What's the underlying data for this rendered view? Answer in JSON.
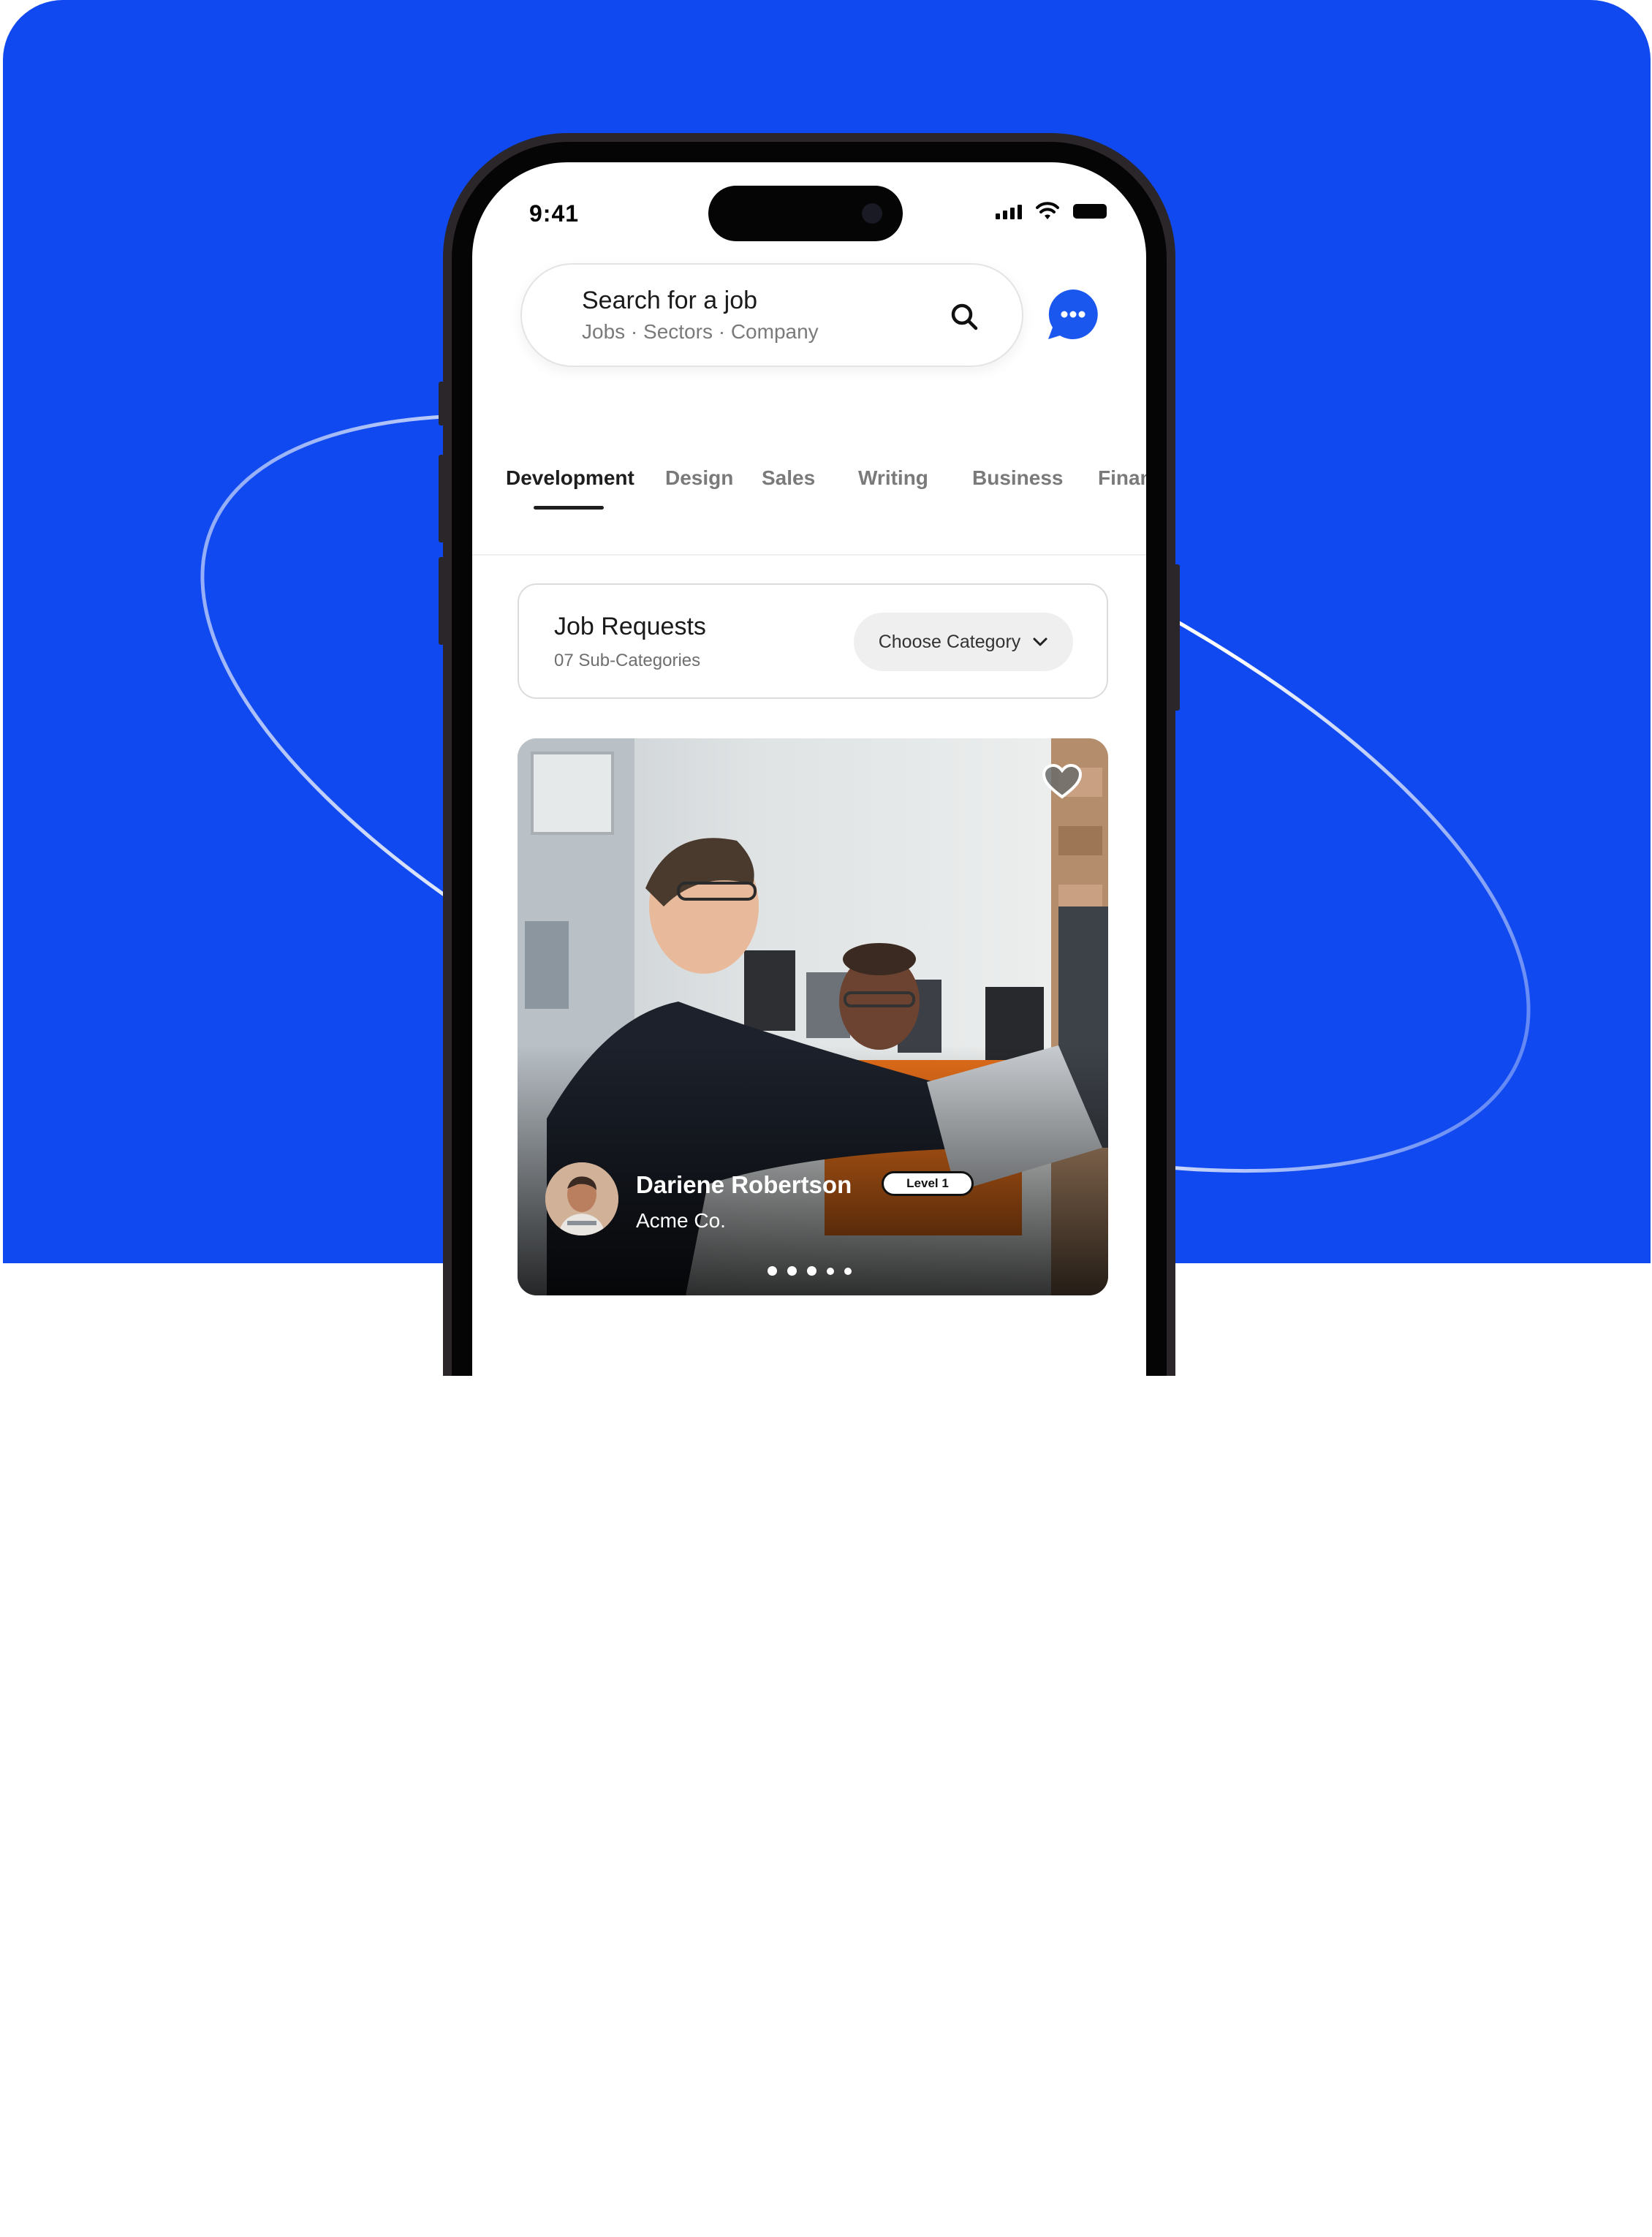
{
  "status_bar": {
    "time": "9:41"
  },
  "search": {
    "title": "Search for a job",
    "subtitle": "Jobs · Sectors · Company"
  },
  "tabs": [
    {
      "label": "Development",
      "active": true
    },
    {
      "label": "Design"
    },
    {
      "label": "Sales"
    },
    {
      "label": "Writing"
    },
    {
      "label": "Business"
    },
    {
      "label": "Finan"
    }
  ],
  "job_requests": {
    "title": "Job Requests",
    "subtitle": "07 Sub-Categories",
    "dropdown_label": "Choose Category"
  },
  "featured": {
    "name": "Dariene Robertson",
    "company": "Acme Co.",
    "level": "Level 1",
    "carousel_count": 5,
    "carousel_active": 1
  },
  "colors": {
    "brand_blue": "#1049f0",
    "chat_blue": "#1a57ef",
    "text_dark": "#1a1a1a",
    "text_muted": "#7a7a7a"
  },
  "icons": [
    "search-icon",
    "chat-icon",
    "heart-icon",
    "chevron-down-icon",
    "wifi-icon",
    "signal-icon",
    "battery-icon"
  ]
}
